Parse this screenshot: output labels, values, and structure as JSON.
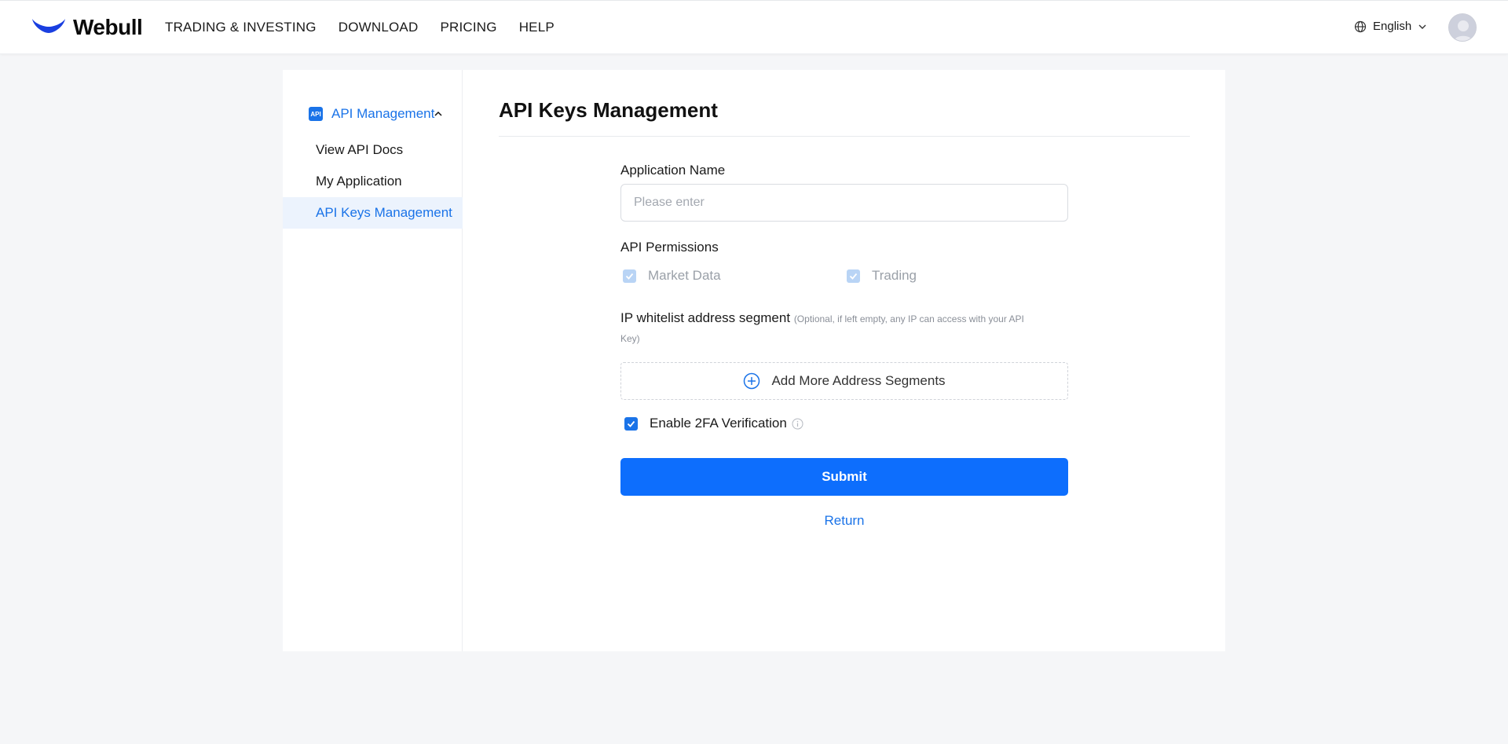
{
  "header": {
    "brand": "Webull",
    "nav": [
      "TRADING & INVESTING",
      "DOWNLOAD",
      "PRICING",
      "HELP"
    ],
    "language": "English",
    "brand_color": "#1a3fe0"
  },
  "sidebar": {
    "group_icon_text": "API",
    "group_label": "API Management",
    "items": [
      {
        "label": "View API Docs",
        "active": false
      },
      {
        "label": "My Application",
        "active": false
      },
      {
        "label": "API Keys Management",
        "active": true
      }
    ]
  },
  "main": {
    "title": "API Keys Management",
    "app_name": {
      "label": "Application Name",
      "placeholder": "Please enter",
      "value": ""
    },
    "permissions": {
      "label": "API Permissions",
      "options": [
        {
          "label": "Market Data",
          "checked": true,
          "disabled": true
        },
        {
          "label": "Trading",
          "checked": true,
          "disabled": true
        }
      ]
    },
    "ip_whitelist": {
      "label": "IP whitelist address segment",
      "note": "(Optional, if left empty, any IP can access with your API",
      "note_line2": "Key)",
      "add_button": "Add More Address Segments"
    },
    "twofa": {
      "label": "Enable 2FA Verification",
      "checked": true
    },
    "submit": "Submit",
    "return": "Return"
  },
  "colors": {
    "accent": "#1a73e8",
    "submit": "#0d6efd",
    "background": "#f5f6f8"
  }
}
